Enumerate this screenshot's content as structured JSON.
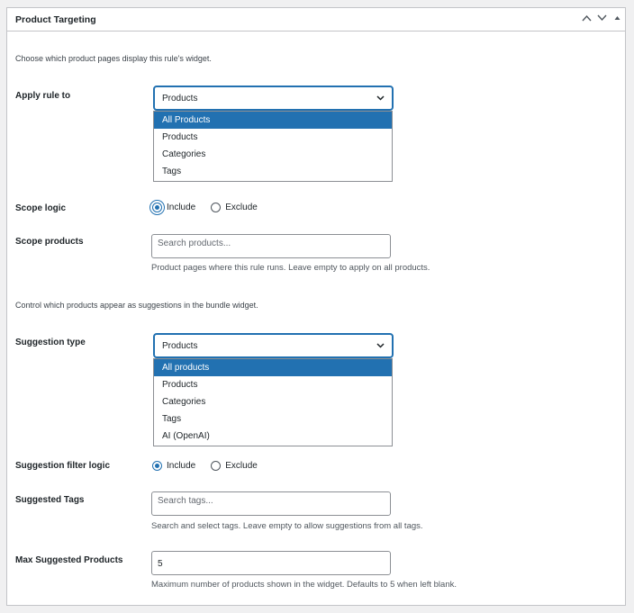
{
  "panel": {
    "title": "Product Targeting",
    "controls": {
      "up": "^",
      "down": "v",
      "toggle": "▲"
    }
  },
  "targeting": {
    "description": "Choose which product pages display this rule's widget.",
    "apply_rule": {
      "label": "Apply rule to",
      "selected": "Products",
      "options": [
        "All Products",
        "Products",
        "Categories",
        "Tags"
      ],
      "highlighted_index": 0
    },
    "scope_logic": {
      "label": "Scope logic",
      "include": "Include",
      "exclude": "Exclude",
      "value": "Include"
    },
    "scope_products": {
      "label": "Scope products",
      "placeholder": "Search products...",
      "help": "Product pages where this rule runs. Leave empty to apply on all products."
    }
  },
  "suggestions": {
    "description": "Control which products appear as suggestions in the bundle widget.",
    "suggestion_type": {
      "label": "Suggestion type",
      "selected": "Products",
      "options": [
        "All products",
        "Products",
        "Categories",
        "Tags",
        "AI (OpenAI)"
      ],
      "highlighted_index": 0
    },
    "filter_logic": {
      "label": "Suggestion filter logic",
      "include": "Include",
      "exclude": "Exclude",
      "value": "Include"
    },
    "suggested_tags": {
      "label": "Suggested Tags",
      "placeholder": "Search tags...",
      "help": "Search and select tags. Leave empty to allow suggestions from all tags."
    },
    "max_products": {
      "label": "Max Suggested Products",
      "value": "5",
      "help": "Maximum number of products shown in the widget. Defaults to 5 when left blank."
    }
  },
  "colors": {
    "accent": "#2271b1",
    "border": "#c3c4c7",
    "background": "#f0f0f1"
  }
}
